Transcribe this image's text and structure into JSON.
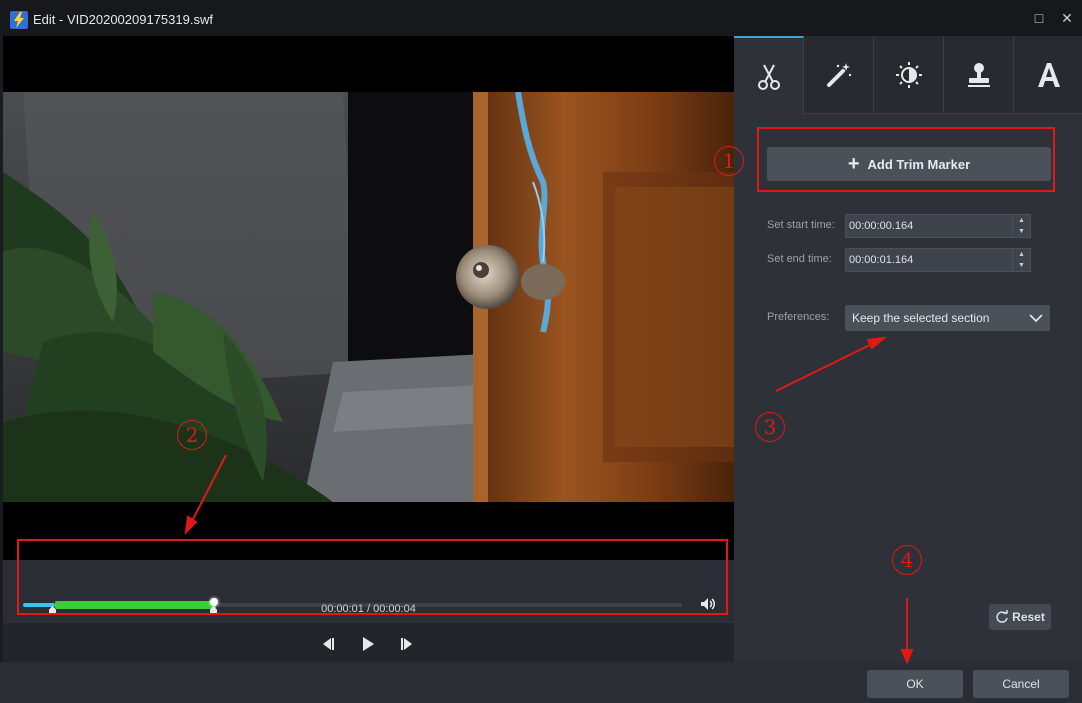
{
  "window": {
    "title": "Edit - VID20200209175319.swf",
    "app_icon": "lightning-app-icon",
    "maximize_icon": "□",
    "close_icon": "✕"
  },
  "player": {
    "timecode": "00:00:01 / 00:00:04",
    "progress_fraction": 0.25,
    "trim_start_fraction": 0.04,
    "trim_end_fraction": 0.29
  },
  "tabs": [
    {
      "name": "trim",
      "icon": "scissors-icon",
      "active": true
    },
    {
      "name": "effects",
      "icon": "magic-wand-icon",
      "active": false
    },
    {
      "name": "adjust",
      "icon": "brightness-icon",
      "active": false
    },
    {
      "name": "watermark",
      "icon": "stamp-icon",
      "active": false
    },
    {
      "name": "text",
      "icon": "text-A-icon",
      "active": false
    }
  ],
  "trim": {
    "add_marker_label": "Add Trim Marker",
    "start_label": "Set start time:",
    "start_value": "00:00:00.164",
    "end_label": "Set end time:",
    "end_value": "00:00:01.164",
    "preferences_label": "Preferences:",
    "preferences_value": "Keep the selected section",
    "reset_label": "Reset"
  },
  "footer": {
    "ok_label": "OK",
    "cancel_label": "Cancel"
  },
  "annotations": [
    "1",
    "2",
    "3",
    "4"
  ],
  "colors": {
    "annotation": "#e01818",
    "trim_selection": "#3bcc3b",
    "accent": "#3aa2d9"
  }
}
